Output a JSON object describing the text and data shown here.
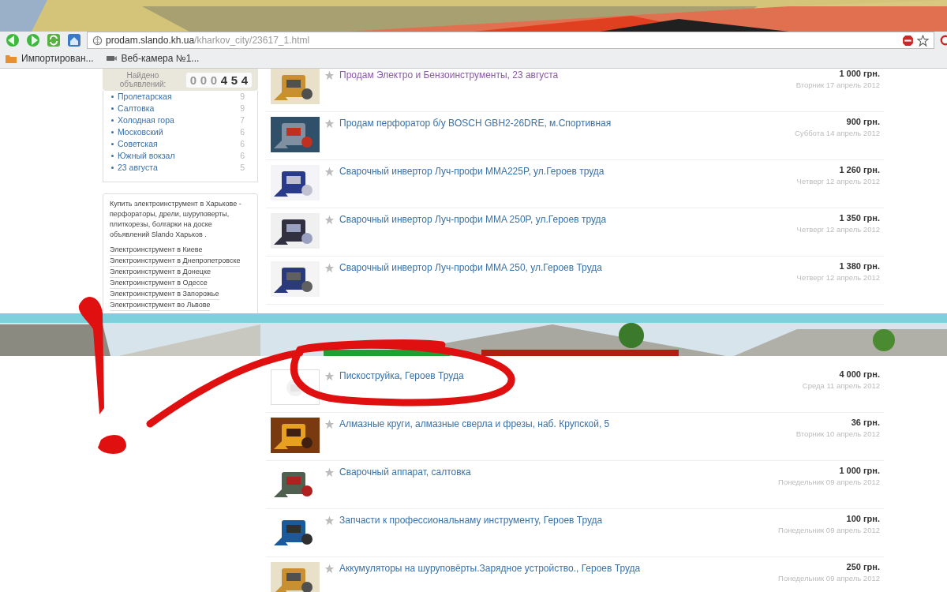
{
  "browser": {
    "url_host": "prodam.slando.kh.ua",
    "url_path": "/kharkov_city/23617_1.html",
    "bookmarks": [
      {
        "label": "Импортирован...",
        "kind": "folder"
      },
      {
        "label": "Веб-камера №1...",
        "kind": "camera"
      }
    ]
  },
  "sidebar": {
    "counter": {
      "label": "Найдено объявлений:",
      "digits": [
        {
          "digit": "0",
          "dim": true
        },
        {
          "digit": "0",
          "dim": true
        },
        {
          "digit": "0",
          "dim": true
        },
        {
          "digit": "4",
          "dim": false
        },
        {
          "digit": "5",
          "dim": false
        },
        {
          "digit": "4",
          "dim": false
        }
      ]
    },
    "districts": [
      {
        "name": "Пролетарская",
        "count": "9"
      },
      {
        "name": "Салтовка",
        "count": "9"
      },
      {
        "name": "Холодная гора",
        "count": "7"
      },
      {
        "name": "Московский",
        "count": "6"
      },
      {
        "name": "Советская",
        "count": "6"
      },
      {
        "name": "Южный вокзал",
        "count": "6"
      },
      {
        "name": "23 августа",
        "count": "5"
      }
    ],
    "info": {
      "text": "Купить электроинструмент в Харькове - перфораторы, дрели, шуруповерты, плиткорезы, болгарки на доске объявлений Slando Харьков .",
      "links": [
        "Электроинструмент в Киеве",
        "Электроинструмент в Днепропетровске",
        "Электроинструмент в Донецке",
        "Электроинструмент в Одессе",
        "Электроинструмент в Запорожье",
        "Электроинструмент во Львове"
      ]
    }
  },
  "listings_top": [
    {
      "title": "Продам Электро и Бензоинструменты, 23 августа",
      "price": "1 000 грн.",
      "date": "Вторник 17 апрель 2012",
      "visited": true
    },
    {
      "title": "Продам перфоратор б/у BOSCH GBH2-26DRE, м.Спортивная",
      "price": "900 грн.",
      "date": "Суббота 14 апрель 2012",
      "visited": false
    },
    {
      "title": "Сварочный инвертор Луч-профи MMA225P, ул.Героев труда",
      "price": "1 260 грн.",
      "date": "Четверг 12 апрель 2012",
      "visited": false
    },
    {
      "title": "Сварочный инвертор Луч-профи MMA 250P, ул.Героев труда",
      "price": "1 350 грн.",
      "date": "Четверг 12 апрель 2012",
      "visited": false
    },
    {
      "title": "Сварочный инвертор Луч-профи MMA 250, ул.Героев Труда",
      "price": "1 380 грн.",
      "date": "Четверг 12 апрель 2012",
      "visited": false
    }
  ],
  "listings_bottom": [
    {
      "title": "Пискоструйка, Героев Труда",
      "price": "4 000 грн.",
      "date": "Среда 11 апрель 2012",
      "visited": false,
      "kind": "placeholder"
    },
    {
      "title": "Алмазные круги, алмазные сверла и фрезы, наб. Крупской, 5",
      "price": "36 грн.",
      "date": "Вторник 10 апрель 2012",
      "visited": false
    },
    {
      "title": "Сварочный аппарат, салтовка",
      "price": "1 000 грн.",
      "date": "Понедельник 09 апрель 2012",
      "visited": false
    },
    {
      "title": "Запчасти к профессиональнаму инструменту, Героев Труда",
      "price": "100 грн.",
      "date": "Понедельник 09 апрель 2012",
      "visited": false
    },
    {
      "title": "Аккумуляторы на шуруповёрты.Зарядное устройство., Героев Труда",
      "price": "250 грн.",
      "date": "Понедельник 09 апрель 2012",
      "visited": false
    }
  ]
}
